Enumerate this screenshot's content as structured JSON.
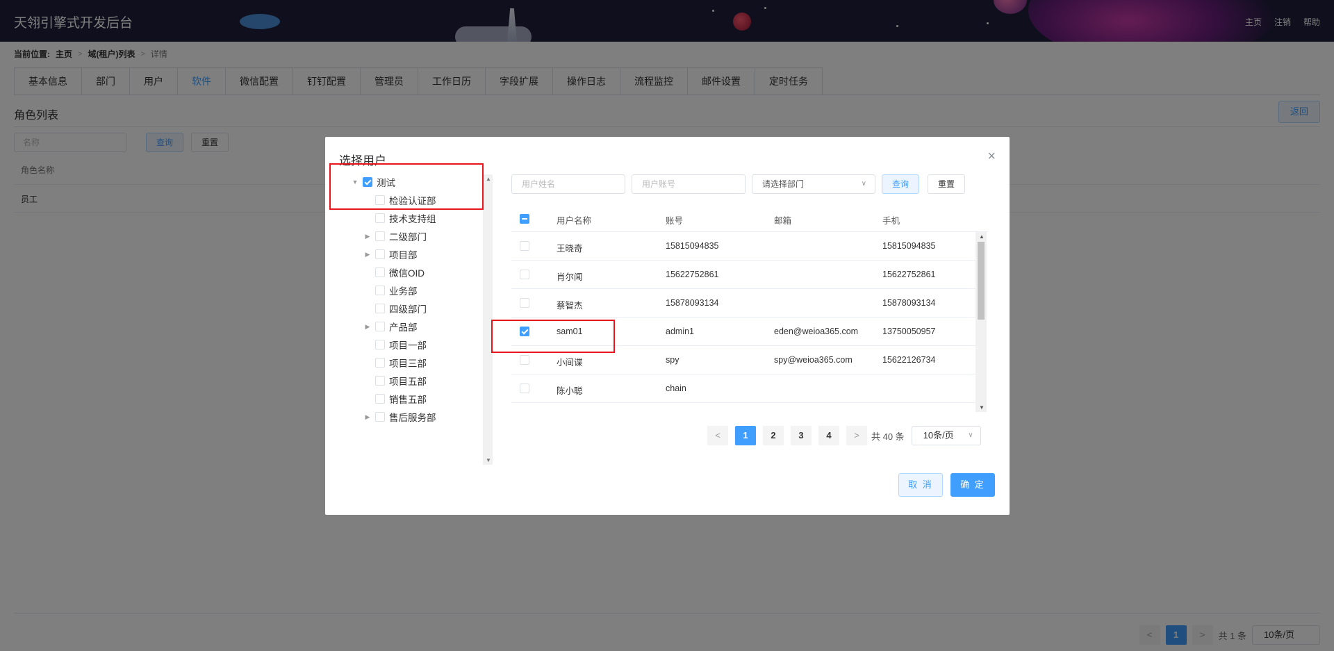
{
  "header": {
    "app_title": "天翎引擎式开发后台",
    "nav": [
      "主页",
      "注销",
      "帮助"
    ]
  },
  "breadcrumb": {
    "label": "当前位置:",
    "items": [
      "主页",
      "域(租户)列表",
      "详情"
    ]
  },
  "tabs": [
    "基本信息",
    "部门",
    "用户",
    "软件",
    "微信配置",
    "钉钉配置",
    "管理员",
    "工作日历",
    "字段扩展",
    "操作日志",
    "流程监控",
    "邮件设置",
    "定时任务"
  ],
  "active_tab": "软件",
  "roles_page": {
    "title": "角色列表",
    "back_label": "返回",
    "name_placeholder": "名称",
    "query_label": "查询",
    "reset_label": "重置",
    "column_header": "角色名称",
    "rows": [
      "员工"
    ],
    "pager": {
      "current": "1",
      "total": "共 1 条",
      "page_size": "10条/页"
    }
  },
  "dialog": {
    "title": "选择用户",
    "tree": [
      {
        "label": "测试",
        "checked": true,
        "expanded": true
      },
      {
        "label": "检验认证部",
        "checked": false
      },
      {
        "label": "技术支持组",
        "checked": false
      },
      {
        "label": "二级部门",
        "checked": false,
        "has_children": true
      },
      {
        "label": "项目部",
        "checked": false,
        "has_children": true
      },
      {
        "label": "微信OID",
        "checked": false
      },
      {
        "label": "业务部",
        "checked": false
      },
      {
        "label": "四级部门",
        "checked": false
      },
      {
        "label": "产品部",
        "checked": false,
        "has_children": true
      },
      {
        "label": "项目一部",
        "checked": false
      },
      {
        "label": "项目三部",
        "checked": false
      },
      {
        "label": "项目五部",
        "checked": false
      },
      {
        "label": "销售五部",
        "checked": false
      },
      {
        "label": "售后服务部",
        "checked": false,
        "has_children": true
      }
    ],
    "filters": {
      "name_placeholder": "用户姓名",
      "account_placeholder": "用户账号",
      "dept_placeholder": "请选择部门",
      "query_label": "查询",
      "reset_label": "重置"
    },
    "table": {
      "columns": [
        "用户名称",
        "账号",
        "邮箱",
        "手机"
      ],
      "rows": [
        {
          "name": "王晓奇",
          "account": "15815094835",
          "email": "",
          "phone": "15815094835",
          "checked": false
        },
        {
          "name": "肖尔闻",
          "account": "15622752861",
          "email": "",
          "phone": "15622752861",
          "checked": false
        },
        {
          "name": "蔡智杰",
          "account": "15878093134",
          "email": "",
          "phone": "15878093134",
          "checked": false
        },
        {
          "name": "sam01",
          "account": "admin1",
          "email": "eden@weioa365.com",
          "phone": "13750050957",
          "checked": true
        },
        {
          "name": "小间谍",
          "account": "spy",
          "email": "spy@weioa365.com",
          "phone": "15622126734",
          "checked": false
        },
        {
          "name": "陈小聪",
          "account": "chain",
          "email": "",
          "phone": "",
          "checked": false
        }
      ]
    },
    "pager": {
      "pages": [
        "1",
        "2",
        "3",
        "4"
      ],
      "current": "1",
      "total": "共 40 条",
      "page_size": "10条/页"
    },
    "cancel_label": "取 消",
    "ok_label": "确 定"
  },
  "colors": {
    "header_bg": "#1e1f3b",
    "primary": "#409eff",
    "annotation": "#e8161c"
  }
}
